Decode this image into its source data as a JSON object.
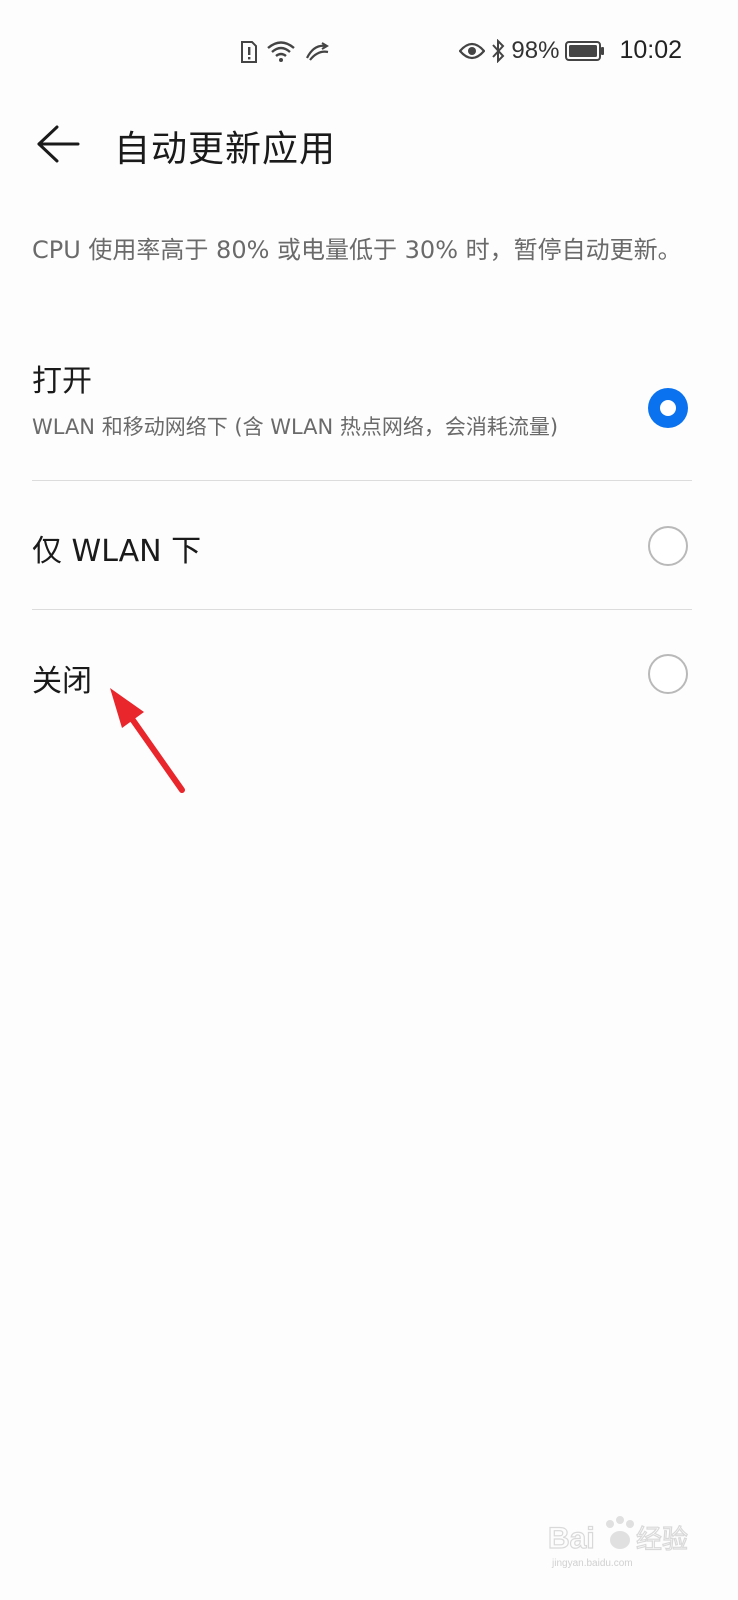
{
  "status_bar": {
    "battery_percent": "98%",
    "time": "10:02",
    "icons": [
      "sim-alert-icon",
      "wifi-icon",
      "data-activity-icon",
      "eye-comfort-icon",
      "bluetooth-icon",
      "battery-icon"
    ]
  },
  "app_bar": {
    "title": "自动更新应用",
    "back_icon": "back-arrow-icon"
  },
  "description": "CPU 使用率高于 80% 或电量低于 30% 时，暂停自动更新。",
  "options": [
    {
      "label": "打开",
      "subtitle": "WLAN 和移动网络下 (含 WLAN 热点网络，会消耗流量)",
      "selected": true
    },
    {
      "label": "仅 WLAN 下",
      "subtitle": "",
      "selected": false
    },
    {
      "label": "关闭",
      "subtitle": "",
      "selected": false
    }
  ],
  "colors": {
    "accent": "#0a72ef",
    "annotation_arrow": "#e8262b"
  },
  "watermark": {
    "brand": "Bai du",
    "text": "经验",
    "url": "jingyan.baidu.com"
  }
}
